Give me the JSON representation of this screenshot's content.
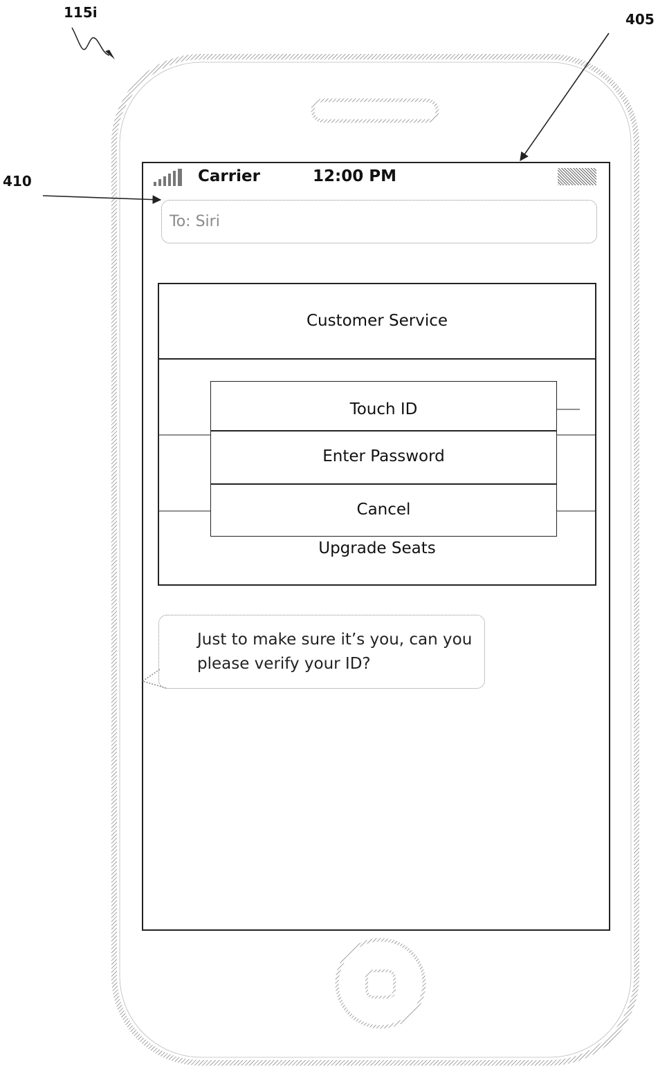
{
  "figure": {
    "label_device": "115i",
    "label_screen": "405",
    "label_to_field": "410"
  },
  "status_bar": {
    "carrier": "Carrier",
    "time": "12:00 PM"
  },
  "compose": {
    "to_text": "To: Siri"
  },
  "panel": {
    "title": "Customer Service",
    "underlying_item": "Upgrade Seats"
  },
  "auth_sheet": {
    "touch_id": "Touch ID",
    "enter_password": "Enter Password",
    "cancel": "Cancel"
  },
  "message": {
    "line1": "Just to make sure it’s you, can you",
    "line2": "please verify your ID?"
  },
  "icons": {
    "signal": "signal-bars-icon",
    "battery": "battery-icon",
    "home": "home-button-icon",
    "speaker": "speaker-slot-icon"
  }
}
